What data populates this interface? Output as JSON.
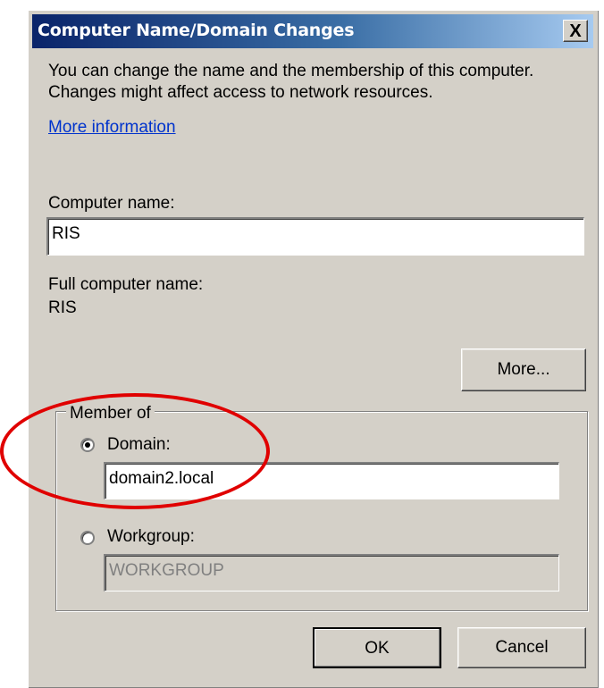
{
  "window": {
    "title": "Computer Name/Domain Changes",
    "close_label": "X"
  },
  "description": "You can change the name and the membership of this computer. Changes might affect access to network resources.",
  "more_info_link": "More information",
  "computer_name": {
    "label": "Computer name:",
    "value": "RIS"
  },
  "full_computer_name": {
    "label": "Full computer name:",
    "value": "RIS"
  },
  "more_button": "More...",
  "member_of": {
    "label": "Member of",
    "domain": {
      "label": "Domain:",
      "value": "domain2.local",
      "selected": true
    },
    "workgroup": {
      "label": "Workgroup:",
      "value": "WORKGROUP",
      "selected": false
    }
  },
  "buttons": {
    "ok": "OK",
    "cancel": "Cancel"
  },
  "colors": {
    "dialog_bg": "#d4d0c8",
    "title_start": "#0a246a",
    "title_end": "#a6caf0",
    "link": "#0033cc",
    "annotation": "#e00000"
  }
}
